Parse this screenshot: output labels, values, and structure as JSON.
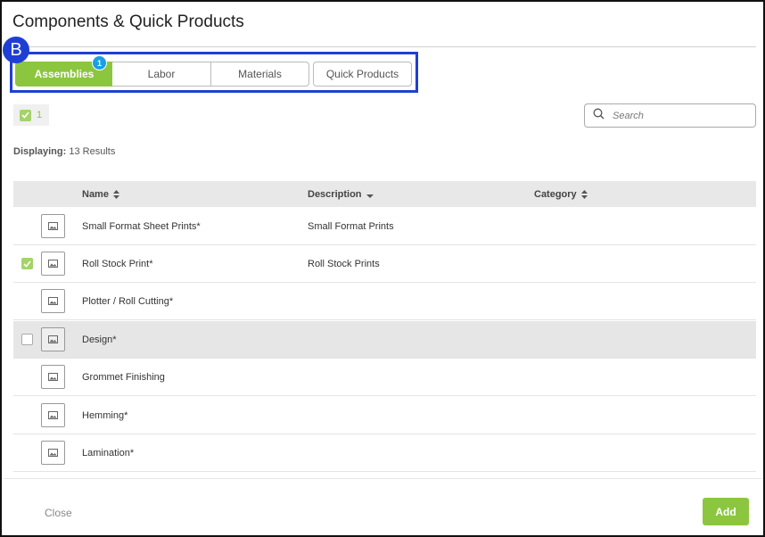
{
  "dialog": {
    "title": "Components & Quick Products"
  },
  "annotation": {
    "label": "B"
  },
  "tabs": [
    {
      "label": "Assemblies",
      "active": true,
      "count": "1"
    },
    {
      "label": "Labor",
      "active": false
    },
    {
      "label": "Materials",
      "active": false
    },
    {
      "label": "Quick Products",
      "active": false
    }
  ],
  "selection": {
    "count": "1"
  },
  "search": {
    "placeholder": "Search"
  },
  "results": {
    "prefix": "Displaying:",
    "text": "13 Results"
  },
  "table": {
    "columns": [
      "Name",
      "Description",
      "Category"
    ],
    "rows": [
      {
        "name": "Small Format Sheet Prints*",
        "description": "Small Format Prints",
        "checked": false
      },
      {
        "name": "Roll Stock Print*",
        "description": "Roll Stock Prints",
        "checked": true
      },
      {
        "name": "Plotter / Roll Cutting*",
        "description": "",
        "checked": false
      },
      {
        "name": "Design*",
        "description": "",
        "checked": false,
        "hovered": true
      },
      {
        "name": "Grommet Finishing",
        "description": "",
        "checked": false
      },
      {
        "name": "Hemming*",
        "description": "",
        "checked": false
      },
      {
        "name": "Lamination*",
        "description": "",
        "checked": false
      }
    ]
  },
  "footer": {
    "close_label": "Close",
    "add_label": "Add"
  },
  "colors": {
    "accent": "#8cc63f",
    "annotation_blue": "#1f3fd4",
    "badge_blue": "#1a9fe0"
  },
  "icons": {
    "thumbnail": "image-placeholder-icon",
    "search": "search-icon",
    "sort": "sort-icon"
  }
}
